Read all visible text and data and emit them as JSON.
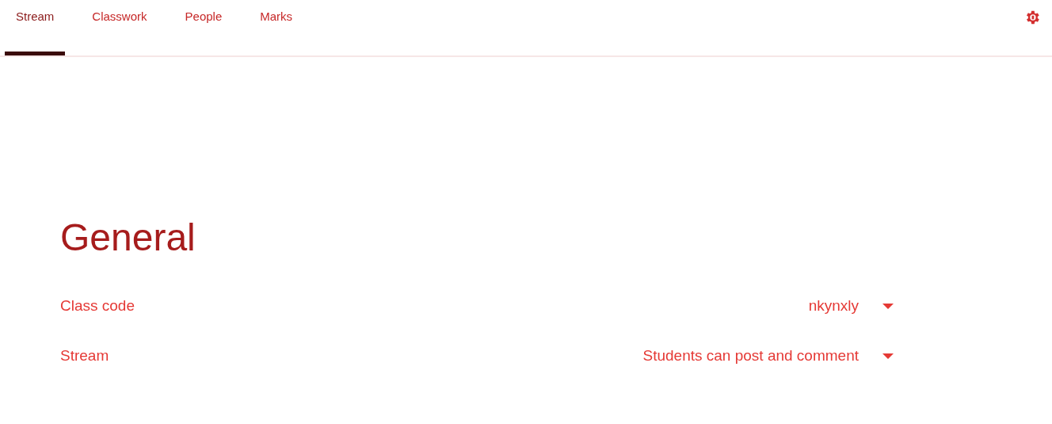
{
  "tabs": [
    {
      "label": "Stream",
      "selected": true
    },
    {
      "label": "Classwork",
      "selected": false
    },
    {
      "label": "People",
      "selected": false
    },
    {
      "label": "Marks",
      "selected": false
    }
  ],
  "section": {
    "title": "General",
    "settings": [
      {
        "label": "Class code",
        "value": "nkynxly"
      },
      {
        "label": "Stream",
        "value": "Students can post and comment"
      }
    ]
  }
}
